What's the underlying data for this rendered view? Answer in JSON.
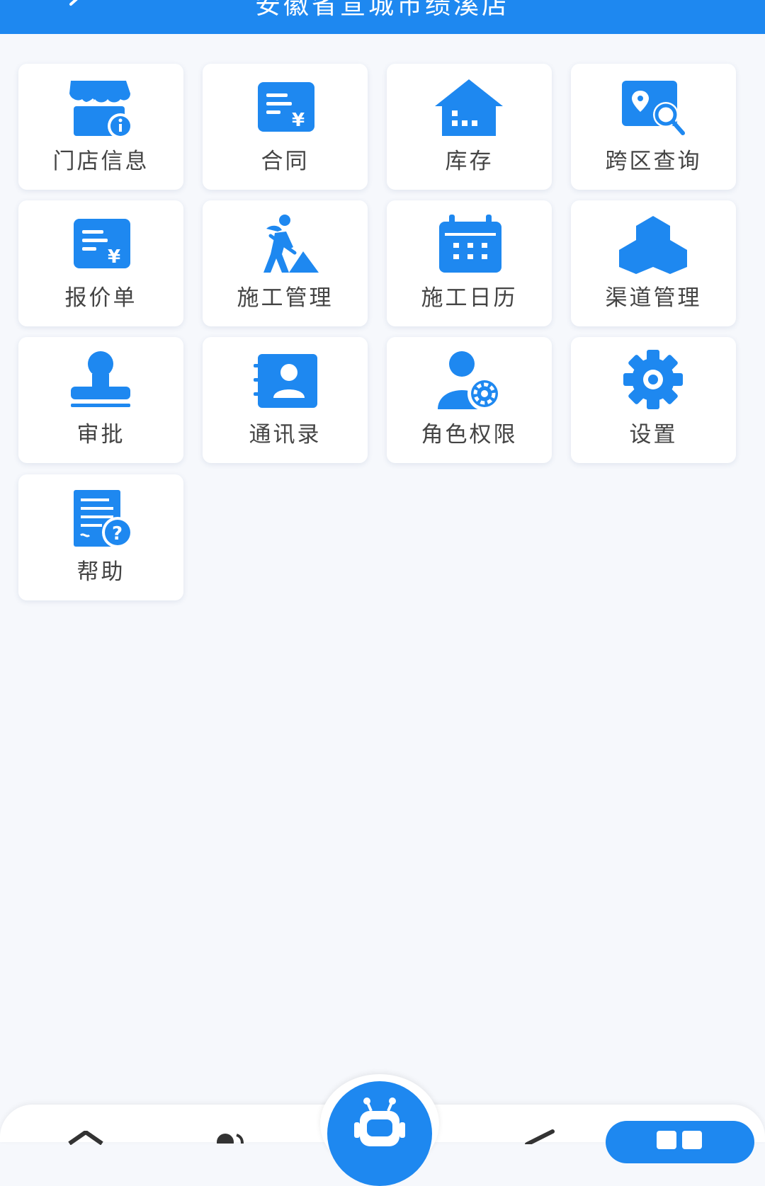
{
  "header": {
    "title": "安徽省宣城市绩溪店",
    "background": "#1e88f0"
  },
  "accent_color": "#1e88f0",
  "grid_items": [
    {
      "label": "门店信息",
      "icon": "store-info-icon"
    },
    {
      "label": "合同",
      "icon": "contract-icon"
    },
    {
      "label": "库存",
      "icon": "warehouse-icon"
    },
    {
      "label": "跨区查询",
      "icon": "map-search-icon"
    },
    {
      "label": "报价单",
      "icon": "quote-icon"
    },
    {
      "label": "施工管理",
      "icon": "construction-worker-icon"
    },
    {
      "label": "施工日历",
      "icon": "calendar-icon"
    },
    {
      "label": "渠道管理",
      "icon": "channels-icon"
    },
    {
      "label": "审批",
      "icon": "stamp-icon"
    },
    {
      "label": "通讯录",
      "icon": "contacts-icon"
    },
    {
      "label": "角色权限",
      "icon": "user-settings-icon"
    },
    {
      "label": "设置",
      "icon": "gear-icon"
    },
    {
      "label": "帮助",
      "icon": "help-document-icon"
    }
  ],
  "tabbar": {
    "icons": [
      "home-icon",
      "person-icon",
      "robot-icon",
      "pen-icon",
      "grid-icon"
    ],
    "active": "grid-icon"
  }
}
